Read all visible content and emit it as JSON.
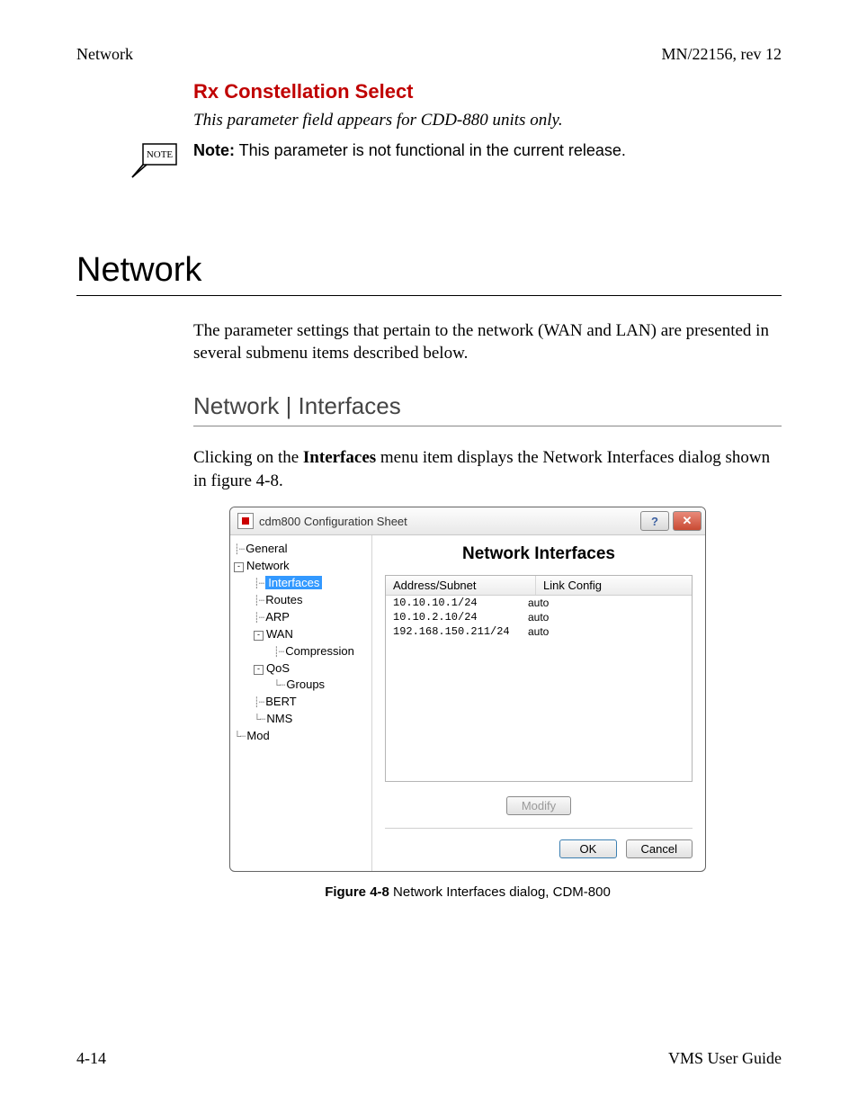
{
  "header": {
    "left": "Network",
    "right": "MN/22156, rev 12"
  },
  "section1": {
    "title": "Rx Constellation Select",
    "italic_line": "This parameter field appears for CDD-880 units only.",
    "note_label": "Note:",
    "note_text": "  This parameter is not functional in the current release.",
    "note_icon_text": "NOTE"
  },
  "h1": "Network",
  "intro": "The parameter settings that pertain to the network (WAN and LAN) are presented in several submenu items described below.",
  "h2": "Network | Interfaces",
  "para2_pre": "Clicking on the ",
  "para2_b": "Interfaces",
  "para2_post": " menu item displays the Network Interfaces dialog shown in figure 4-8.",
  "dialog": {
    "title": "cdm800 Configuration Sheet",
    "help_glyph": "?",
    "close_glyph": "✕",
    "pane_title": "Network Interfaces",
    "col_addr": "Address/Subnet",
    "col_link": "Link Config",
    "rows": [
      {
        "addr": "10.10.10.1/24",
        "link": "auto"
      },
      {
        "addr": "10.10.2.10/24",
        "link": "auto"
      },
      {
        "addr": "192.168.150.211/24",
        "link": "auto"
      }
    ],
    "modify_btn": "Modify",
    "ok_btn": "OK",
    "cancel_btn": "Cancel",
    "tree": {
      "general": "General",
      "network": "Network",
      "interfaces": "Interfaces",
      "routes": "Routes",
      "arp": "ARP",
      "wan": "WAN",
      "compression": "Compression",
      "qos": "QoS",
      "groups": "Groups",
      "bert": "BERT",
      "nms": "NMS",
      "mod": "Mod"
    }
  },
  "figure": {
    "label": "Figure 4-8",
    "caption": "   Network Interfaces dialog, CDM-800"
  },
  "footer": {
    "left": "4-14",
    "right": "VMS User Guide"
  }
}
